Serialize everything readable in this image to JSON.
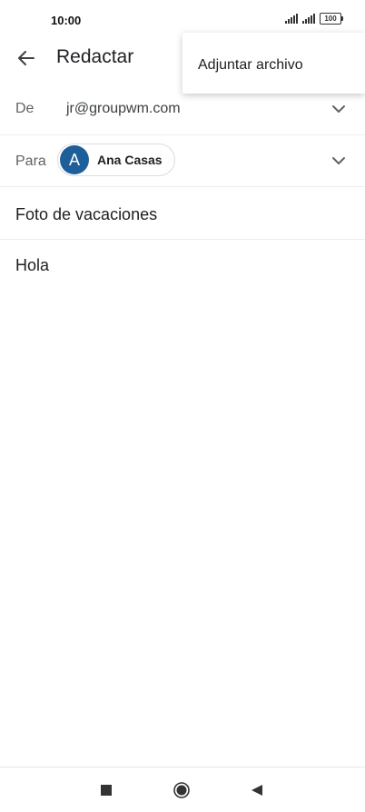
{
  "status_bar": {
    "time": "10:00",
    "battery": "100"
  },
  "header": {
    "title": "Redactar"
  },
  "menu": {
    "items": [
      {
        "label": "Adjuntar archivo"
      }
    ]
  },
  "compose": {
    "from": {
      "label": "De",
      "value": "jr@groupwm.com"
    },
    "to": {
      "label": "Para",
      "recipient": {
        "initial": "A",
        "name": "Ana Casas"
      }
    },
    "subject": "Foto de vacaciones",
    "body": "Hola"
  },
  "colors": {
    "avatar": "#1f5f99",
    "text": "#202124",
    "secondary": "#5f6368"
  }
}
